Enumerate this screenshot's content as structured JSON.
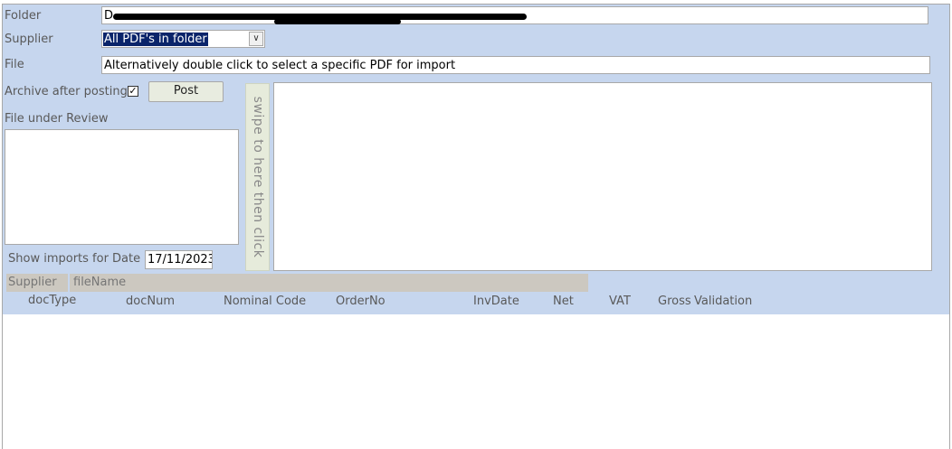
{
  "folder": {
    "label": "Folder",
    "value_visible": "D"
  },
  "supplier": {
    "label": "Supplier",
    "selected": "All PDF's in folder"
  },
  "file": {
    "label": "File",
    "value": "Alternatively double click to select a specific PDF for import"
  },
  "archive": {
    "label": "Archive after posting",
    "checked": true,
    "check_mark": "✓"
  },
  "post_button": {
    "label": "Post"
  },
  "file_review": {
    "label": "File under Review"
  },
  "swipe_panel": {
    "text": "swipe to here then click"
  },
  "show_imports": {
    "label": "Show imports for Date",
    "date": "17/11/2023"
  },
  "list_header": {
    "supplier": "Supplier",
    "filename": "fileName"
  },
  "columns": [
    "docType",
    "docNum",
    "Nominal Code",
    "OrderNo",
    "InvDate",
    "Net",
    "VAT",
    "Gross",
    "Validation"
  ],
  "icons": {
    "dropdown": "chevron-down-icon",
    "checkbox": "checkmark-icon"
  }
}
